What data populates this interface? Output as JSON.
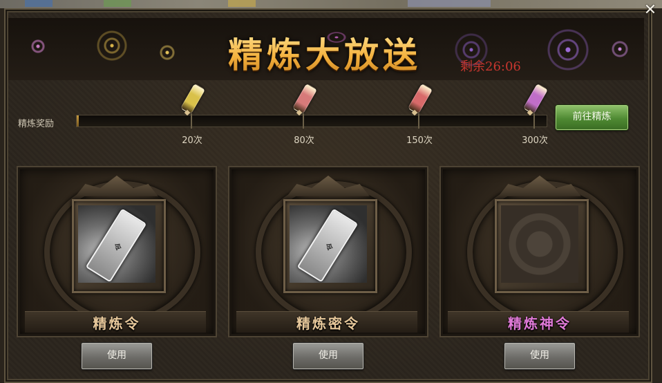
{
  "window": {
    "title": "精炼大放送",
    "countdown": "剩余26:06",
    "close_icon": "close-icon"
  },
  "progress": {
    "label": "精炼奖励",
    "fill_fraction": 0.004,
    "goto_label": "前往精炼",
    "milestones": [
      {
        "count_label": "20次",
        "rod_color": "#d9c14a",
        "icon": "golden-rod-icon"
      },
      {
        "count_label": "80次",
        "rod_color": "#d77a7a",
        "icon": "red-rod-icon"
      },
      {
        "count_label": "150次",
        "rod_color": "#d86a6a",
        "icon": "red-rod-icon"
      },
      {
        "count_label": "300次",
        "rod_color": "#c06ec8",
        "icon": "purple-rod-icon"
      }
    ]
  },
  "cards": [
    {
      "name": "精炼令",
      "name_color": "#e6c79a",
      "item_icon": "token-icon",
      "has_item": true,
      "use_label": "使用"
    },
    {
      "name": "精炼密令",
      "name_color": "#e6c79a",
      "item_icon": "token-icon",
      "has_item": true,
      "use_label": "使用"
    },
    {
      "name": "精炼神令",
      "name_color": "#e07ad8",
      "item_icon": "empty-slot-icon",
      "has_item": false,
      "use_label": "使用"
    }
  ],
  "colors": {
    "title_gold": "#f6cb5a",
    "countdown_red": "#c8362f",
    "goto_green": "#4f8a33"
  }
}
